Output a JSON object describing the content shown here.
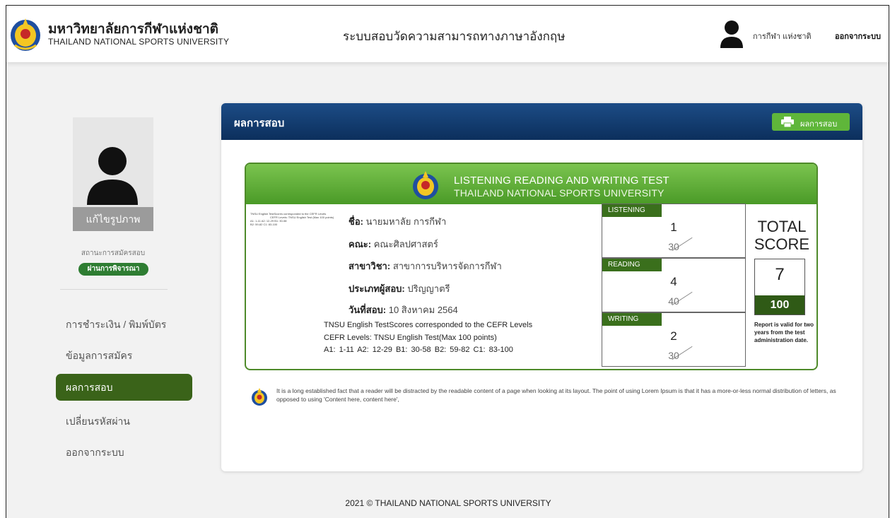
{
  "header": {
    "university_th": "มหาวิทยาลัยการกีฬาแห่งชาติ",
    "university_en": "THAILAND NATIONAL SPORTS UNIVERSITY",
    "system_title": "ระบบสอบวัดความสามารถทางภาษาอังกฤษ",
    "user_name": "การกีฬา แห่งชาติ",
    "logout": "ออกจากระบบ"
  },
  "sidebar": {
    "edit_photo": "แก้ไขรูปภาพ",
    "status_label": "สถานะการสมัครสอบ",
    "status_badge": "ผ่านการพิจารณา",
    "items": [
      {
        "label": "การชำระเงิน / พิมพ์บัตร"
      },
      {
        "label": "ข้อมูลการสมัคร"
      },
      {
        "label": "ผลการสอบ"
      },
      {
        "label": "เปลี่ยนรหัสผ่าน"
      },
      {
        "label": "ออกจากระบบ"
      }
    ]
  },
  "main": {
    "title": "ผลการสอบ",
    "print_button": "ผลการสอบ"
  },
  "certificate": {
    "title_line1": "LISTENING READING AND WRITING TEST",
    "title_line2": "THAILAND NATIONAL SPORTS UNIVERSITY",
    "thumbnail": {
      "line1": "TNSU English TestScores corresponded to the CEFR Levels",
      "line2": "CEFR Levels: TNSU English Test (Max 100 points)",
      "line3": "A1: 1-11      A2: 12-29      B1: 30-58",
      "line4": "B2: 59-82     C1: 83-100"
    },
    "fields": [
      {
        "label": "ชื่อ:",
        "value": "นายมหาลัย การกีฬา"
      },
      {
        "label": "คณะ:",
        "value": "คณะศิลปศาสตร์"
      },
      {
        "label": "สาขาวิชา:",
        "value": "สาขาการบริหารจัดการกีฬา"
      },
      {
        "label": "ประเภทผู้สอบ:",
        "value": "ปริญญาตรี"
      },
      {
        "label": "วันที่สอบ:",
        "value": "10 สิงหาคม 2564"
      }
    ],
    "cefr_line1": "TNSU English TestScores corresponded to the CEFR Levels",
    "cefr_line2": "CEFR Levels: TNSU English Test(Max 100 points)",
    "cefr_levels": "A1: 1-11    A2: 12-29    B1: 30-58    B2: 59-82    C1: 83-100",
    "sections": [
      {
        "name": "LISTENING",
        "score": "1",
        "max": "30"
      },
      {
        "name": "READING",
        "score": "4",
        "max": "40"
      },
      {
        "name": "WRITING",
        "score": "2",
        "max": "30"
      }
    ],
    "total_label": "TOTAL SCORE",
    "total_score": "7",
    "total_max": "100",
    "validity_note": "Report is valid for two years from the test administration date."
  },
  "note": "It is a long established fact that a reader will be distracted by the readable content of a page when looking at its layout. The point of using Lorem Ipsum is that it has a more-or-less normal distribution of letters, as opposed to using 'Content here, content here',",
  "footer": "2021 © THAILAND NATIONAL SPORTS UNIVERSITY",
  "colors": {
    "header_blue": "#1c4c86",
    "green_dark": "#3a6319",
    "green_light": "#7bc44f",
    "print_green": "#5fb63a"
  }
}
